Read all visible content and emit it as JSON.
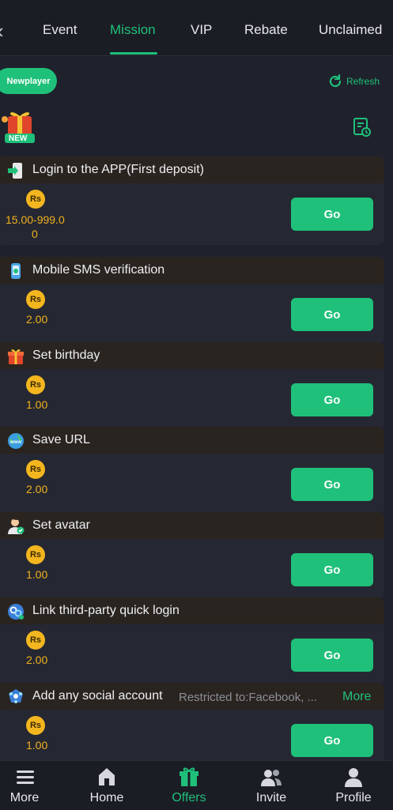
{
  "tabs": [
    {
      "label": "Event"
    },
    {
      "label": "Mission"
    },
    {
      "label": "VIP"
    },
    {
      "label": "Rebate"
    },
    {
      "label": "Unclaimed"
    }
  ],
  "active_tab": "Mission",
  "filter_pill": "Newplayer",
  "refresh_label": "Refresh",
  "badge_text": "NEW",
  "currency_symbol": "Rs",
  "go_label": "Go",
  "missions": [
    {
      "title": "Login to the APP(First deposit)",
      "reward_line1": "15.00-999.0",
      "reward_line2": "0",
      "icon": "phone-login-icon"
    },
    {
      "title": "Mobile SMS verification",
      "reward_line1": "2.00",
      "icon": "sms-phone-icon"
    },
    {
      "title": "Set birthday",
      "reward_line1": "1.00",
      "icon": "gift-icon"
    },
    {
      "title": "Save URL",
      "reward_line1": "2.00",
      "icon": "globe-www-icon"
    },
    {
      "title": "Set avatar",
      "reward_line1": "1.00",
      "icon": "avatar-icon"
    },
    {
      "title": "Link third-party quick login",
      "reward_line1": "2.00",
      "icon": "link-icon"
    },
    {
      "title": "Add any social account",
      "subtitle": "Restricted to:Facebook, ...",
      "more": "More",
      "reward_line1": "1.00",
      "icon": "social-icon"
    }
  ],
  "bottom_nav": [
    {
      "label": "More",
      "icon": "menu-icon"
    },
    {
      "label": "Home",
      "icon": "home-icon"
    },
    {
      "label": "Offers",
      "icon": "gift-icon"
    },
    {
      "label": "Invite",
      "icon": "people-icon"
    },
    {
      "label": "Profile",
      "icon": "profile-icon"
    }
  ],
  "colors": {
    "accent": "#1fc07a",
    "coin": "#f3b61f",
    "background": "#1f222c"
  }
}
